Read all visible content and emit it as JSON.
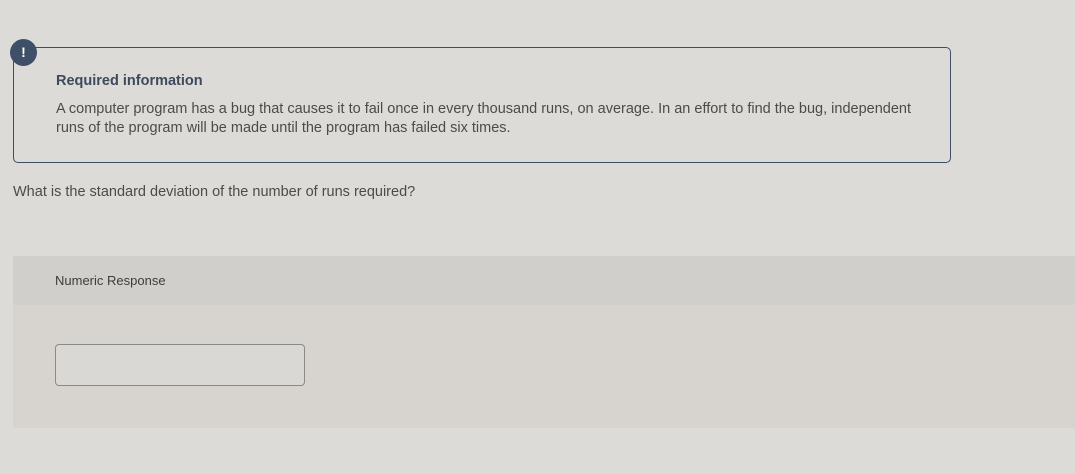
{
  "info": {
    "icon": "exclamation-icon",
    "icon_glyph": "!",
    "title": "Required information",
    "text": "A computer program has a bug that causes it to fail once in every thousand runs, on average. In an effort to find the bug, independent runs of the program will be made until the program has failed six times."
  },
  "question": {
    "text": "What is the standard deviation of the number of runs required?"
  },
  "response": {
    "label": "Numeric Response",
    "value": "",
    "placeholder": ""
  },
  "colors": {
    "accent": "#3d5068",
    "background": "#dcdbd7",
    "panel": "#d7d4d0",
    "panel_header": "#d1cfcb"
  }
}
